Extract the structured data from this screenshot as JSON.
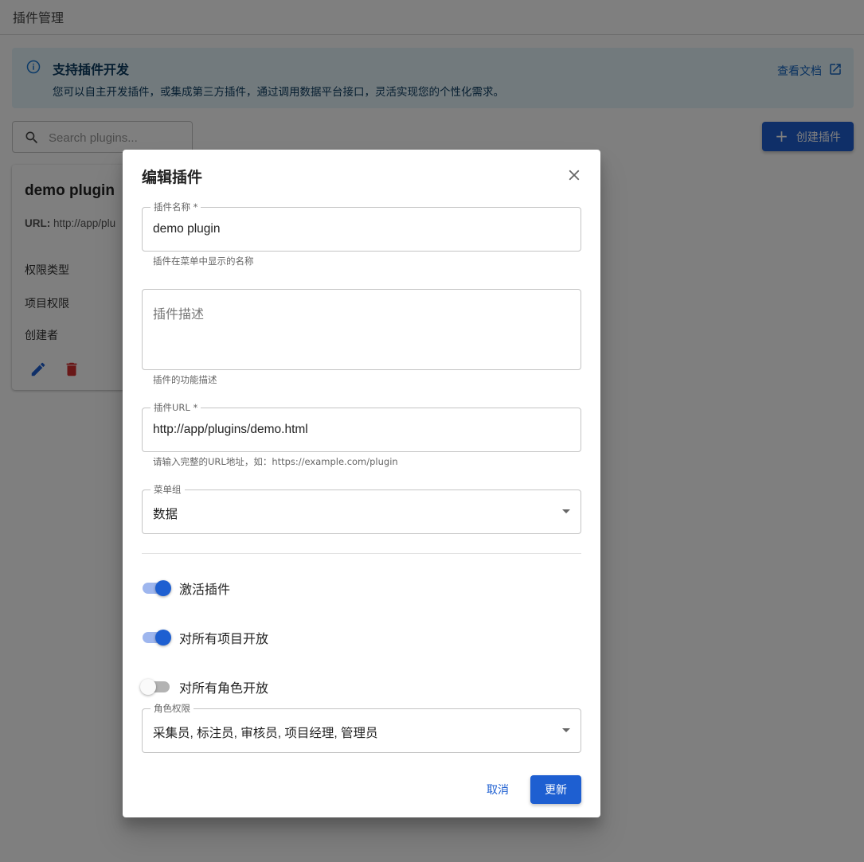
{
  "page": {
    "title": "插件管理"
  },
  "banner": {
    "icon": "info-icon",
    "title": "支持插件开发",
    "description": "您可以自主开发插件，或集成第三方插件，通过调用数据平台接口，灵活实现您的个性化需求。",
    "doc_link": "查看文档",
    "doc_link_icon": "external-link-icon"
  },
  "search": {
    "placeholder": "Search plugins...",
    "value": ""
  },
  "create_button": {
    "icon": "plus-icon",
    "label": "创建插件"
  },
  "plugin_card": {
    "name": "demo plugin",
    "url_label": "URL:",
    "url_value": "http://app/plu",
    "fields": [
      "权限类型",
      "项目权限",
      "创建者"
    ],
    "edit_icon": "pencil-icon",
    "delete_icon": "trash-icon"
  },
  "dialog": {
    "title": "编辑插件",
    "close_icon": "close-icon",
    "name_field": {
      "label": "插件名称 *",
      "value": "demo plugin",
      "helper": "插件在菜单中显示的名称"
    },
    "description_field": {
      "placeholder": "插件描述",
      "value": "",
      "helper": "插件的功能描述"
    },
    "url_field": {
      "label": "插件URL *",
      "value": "http://app/plugins/demo.html",
      "helper": "请输入完整的URL地址，如：https://example.com/plugin"
    },
    "menu_group": {
      "label": "菜单组",
      "value": "数据"
    },
    "switches": [
      {
        "label": "激活插件",
        "checked": true
      },
      {
        "label": "对所有项目开放",
        "checked": true
      },
      {
        "label": "对所有角色开放",
        "checked": false
      }
    ],
    "role_permissions": {
      "label": "角色权限",
      "value": "采集员, 标注员, 审核员, 项目经理, 管理员"
    },
    "cancel_label": "取消",
    "update_label": "更新"
  },
  "colors": {
    "primary": "#1e5fd1",
    "banner_bg": "#e5f4fb",
    "delete": "#d32f2f"
  }
}
